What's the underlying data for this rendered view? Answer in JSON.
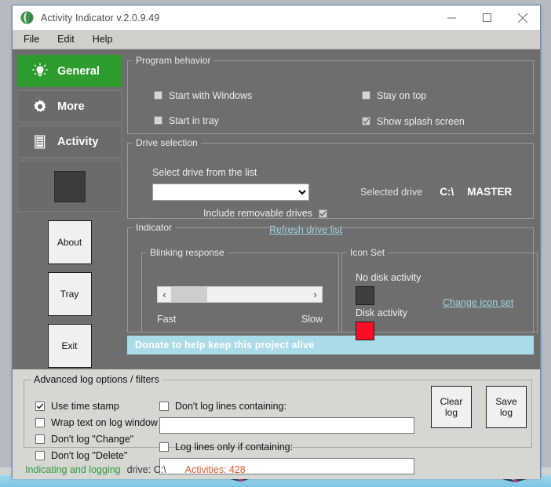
{
  "window": {
    "title": "Activity Indicator v.2.0.9.49",
    "icon": "globe-icon",
    "minimize": "–",
    "maximize": "□",
    "close": "✕"
  },
  "menubar": {
    "items": [
      "File",
      "Edit",
      "Help"
    ]
  },
  "sidebar": {
    "tabs": [
      {
        "label": "General",
        "icon": "lightbulb-icon",
        "active": true
      },
      {
        "label": "More",
        "icon": "gear-icon",
        "active": false
      },
      {
        "label": "Activity",
        "icon": "document-list-icon",
        "active": false
      }
    ],
    "preview_icon": "tray-icon-preview",
    "buttons": [
      "About",
      "Tray",
      "Exit"
    ]
  },
  "program_behavior": {
    "legend": "Program behavior",
    "options": [
      {
        "label": "Start with Windows",
        "checked": false
      },
      {
        "label": "Start in tray",
        "checked": false
      },
      {
        "label": "Stay on top",
        "checked": false
      },
      {
        "label": "Show splash screen",
        "checked": true
      }
    ]
  },
  "drive_selection": {
    "legend": "Drive selection",
    "select_label": "Select drive from the list",
    "combo_value": "",
    "combo_options": [
      ""
    ],
    "include_removable": {
      "label": "Include removable drives",
      "checked": true
    },
    "refresh_link": "Refresh drive list",
    "selected_drive_label": "Selected drive",
    "selected_drive_letter": "C:\\",
    "selected_drive_name": "MASTER"
  },
  "indicator": {
    "legend": "Indicator",
    "blinking": {
      "legend": "Blinking response",
      "left_arrow": "‹",
      "right_arrow": "›",
      "thumb_percent": 26,
      "fast_label": "Fast",
      "slow_label": "Slow"
    },
    "icon_set": {
      "legend": "Icon Set",
      "no_activity_label": "No disk activity",
      "no_activity_color": "#3f3f3f",
      "activity_label": "Disk activity",
      "activity_color": "#fb0d26",
      "change_link": "Change icon set"
    }
  },
  "donate": {
    "text": "Donate to help keep this project alive",
    "color": "#a9dbe8"
  },
  "advanced_log": {
    "legend": "Advanced log options / filters",
    "left_options": [
      {
        "label": "Use time stamp",
        "checked": true
      },
      {
        "label": "Wrap text on log window",
        "checked": false
      },
      {
        "label": "Don't log \"Change\"",
        "checked": false
      },
      {
        "label": "Don't log \"Delete\"",
        "checked": false
      }
    ],
    "filters": [
      {
        "label": "Don't log lines containing:",
        "checked": false,
        "value": ""
      },
      {
        "label": "Log lines only if containing:",
        "checked": false,
        "value": ""
      }
    ],
    "buttons": [
      {
        "line1": "Clear",
        "line2": "log"
      },
      {
        "line1": "Save",
        "line2": "log"
      }
    ]
  },
  "status": {
    "state": "Indicating and logging",
    "drive": "drive: C:\\",
    "activities": "Activities: 428",
    "state_color": "#2f9e3f",
    "activities_color": "#e05a2b"
  }
}
